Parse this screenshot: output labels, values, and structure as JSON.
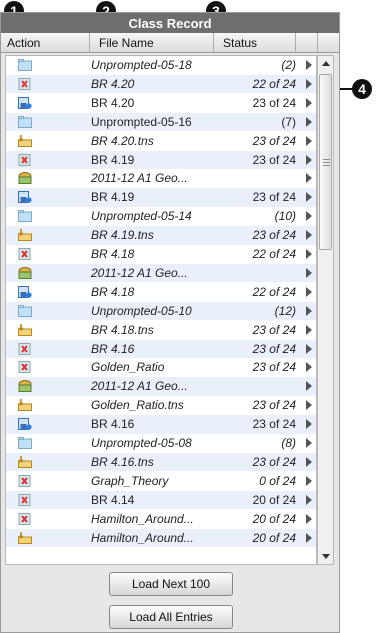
{
  "callouts": [
    "1",
    "2",
    "3",
    "4"
  ],
  "title": "Class Record",
  "columns": {
    "action": "Action",
    "file_name": "File Name",
    "status": "Status"
  },
  "icon_legend": {
    "folder": "folder-icon",
    "x": "not-started-icon",
    "save": "saved-file-icon",
    "collect": "collect-icon",
    "basket": "question-basket-icon"
  },
  "rows": [
    {
      "icon": "folder",
      "name": "Unprompted-05-18",
      "status": "(2)",
      "italic": true
    },
    {
      "icon": "x",
      "name": "BR 4.20",
      "status": "22 of 24",
      "italic": true
    },
    {
      "icon": "save",
      "name": "BR 4.20",
      "status": "23 of 24",
      "italic": false
    },
    {
      "icon": "folder",
      "name": "Unprompted-05-16",
      "status": "(7)",
      "italic": false
    },
    {
      "icon": "collect",
      "name": "BR 4.20.tns",
      "status": "23 of 24",
      "italic": true
    },
    {
      "icon": "x",
      "name": "BR 4.19",
      "status": "23 of 24",
      "italic": false
    },
    {
      "icon": "basket",
      "name": "2011-12 A1 Geo...",
      "status": "",
      "italic": true
    },
    {
      "icon": "save",
      "name": "BR 4.19",
      "status": "23 of 24",
      "italic": false
    },
    {
      "icon": "folder",
      "name": "Unprompted-05-14",
      "status": "(10)",
      "italic": true
    },
    {
      "icon": "collect",
      "name": "BR 4.19.tns",
      "status": "23 of 24",
      "italic": true
    },
    {
      "icon": "x",
      "name": "BR 4.18",
      "status": "22 of 24",
      "italic": true
    },
    {
      "icon": "basket",
      "name": "2011-12 A1 Geo...",
      "status": "",
      "italic": true
    },
    {
      "icon": "save",
      "name": "BR 4.18",
      "status": "22 of 24",
      "italic": true
    },
    {
      "icon": "folder",
      "name": "Unprompted-05-10",
      "status": "(12)",
      "italic": true
    },
    {
      "icon": "collect",
      "name": "BR 4.18.tns",
      "status": "23 of 24",
      "italic": true
    },
    {
      "icon": "x",
      "name": "BR 4.16",
      "status": "23 of 24",
      "italic": true
    },
    {
      "icon": "x",
      "name": "Golden_Ratio",
      "status": "23 of 24",
      "italic": true
    },
    {
      "icon": "basket",
      "name": "2011-12 A1 Geo...",
      "status": "",
      "italic": true
    },
    {
      "icon": "collect",
      "name": "Golden_Ratio.tns",
      "status": "23 of 24",
      "italic": true
    },
    {
      "icon": "save",
      "name": "BR 4.16",
      "status": "23 of 24",
      "italic": false
    },
    {
      "icon": "folder",
      "name": "Unprompted-05-08",
      "status": "(8)",
      "italic": true
    },
    {
      "icon": "collect",
      "name": "BR 4.16.tns",
      "status": "23 of 24",
      "italic": true
    },
    {
      "icon": "x",
      "name": "Graph_Theory",
      "status": "0 of 24",
      "italic": true
    },
    {
      "icon": "x",
      "name": "BR 4.14",
      "status": "20 of 24",
      "italic": false
    },
    {
      "icon": "x",
      "name": "Hamilton_Around...",
      "status": "20 of 24",
      "italic": true
    },
    {
      "icon": "collect",
      "name": "Hamilton_Around...",
      "status": "20 of 24",
      "italic": true
    }
  ],
  "buttons": {
    "load_next": "Load Next 100",
    "load_all": "Load All Entries"
  },
  "colors": {
    "title_bg": "#6e6e6e",
    "alt_row": "#eaf0fb",
    "callout": "#111111"
  }
}
